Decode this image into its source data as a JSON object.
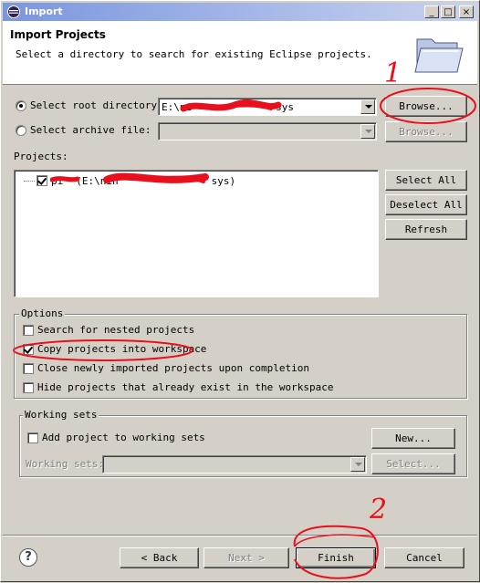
{
  "window": {
    "title": "Import",
    "controls": {
      "minimize": "_",
      "maximize": "□",
      "close": "×"
    }
  },
  "header": {
    "title": "Import Projects",
    "description": "Select a directory to search for existing Eclipse projects."
  },
  "source": {
    "root_label": "Select root directory:",
    "root_value": "E:\\ni",
    "root_value_tail": "sys",
    "archive_label": "Select archive file:",
    "archive_value": "",
    "browse_label": "Browse...",
    "browse_disabled_label": "Browse..."
  },
  "projects": {
    "label": "Projects:",
    "items": [
      {
        "name": "pi",
        "path_head": "(E:\\nin",
        "path_tail": "sys)",
        "checked": true
      }
    ],
    "select_all": "Select All",
    "deselect_all": "Deselect All",
    "refresh": "Refresh"
  },
  "options": {
    "label": "Options",
    "nested": "Search for nested projects",
    "copy": "Copy projects into workspace",
    "close": "Close newly imported projects upon completion",
    "hide": "Hide projects that already exist in the workspace"
  },
  "working_sets": {
    "label": "Working sets",
    "add": "Add project to working sets",
    "sets_label": "Working sets:",
    "new_btn": "New...",
    "select_btn": "Select..."
  },
  "footer": {
    "help": "?",
    "back": "< Back",
    "next": "Next >",
    "finish": "Finish",
    "cancel": "Cancel"
  },
  "annotations": {
    "step1": "1",
    "step2": "2",
    "color": "#e8101c"
  },
  "icons": {
    "app": "eclipse-icon",
    "banner": "folder-icon",
    "help": "help-icon"
  }
}
